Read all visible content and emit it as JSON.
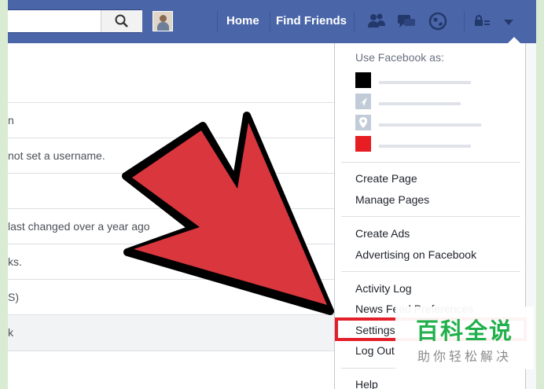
{
  "topbar": {
    "nav": {
      "home": "Home",
      "find_friends": "Find Friends"
    },
    "icons": [
      "search-icon",
      "profile-avatar",
      "friend-requests-icon",
      "messages-icon",
      "notifications-globe-icon",
      "privacy-lock-icon",
      "account-menu-caret-icon"
    ],
    "colors": {
      "bar": "#4a66a8",
      "text": "#ffffff"
    }
  },
  "settings": {
    "rows": [
      "n",
      "not set a username.",
      "",
      "last changed over a year ago",
      "ks.",
      "S)",
      "k"
    ]
  },
  "dropdown": {
    "header": "Use Facebook as:",
    "pages": [
      {
        "color": "#000000"
      },
      {
        "color": "#c2ccd8"
      },
      {
        "color": "#c2ccd8"
      },
      {
        "color": "#e61d23"
      }
    ],
    "group1": [
      "Create Page",
      "Manage Pages"
    ],
    "group2": [
      "Create Ads",
      "Advertising on Facebook"
    ],
    "group3": [
      "Activity Log",
      "News Feed Preferences",
      "Settings",
      "Log Out"
    ],
    "group4": [
      "Help"
    ]
  },
  "annotation": {
    "arrow_color": "#d9363e",
    "highlight_color": "#e3202a"
  },
  "watermark": {
    "main": "百科全说",
    "sub": "助你轻松解决",
    "color": "#21b04b"
  }
}
